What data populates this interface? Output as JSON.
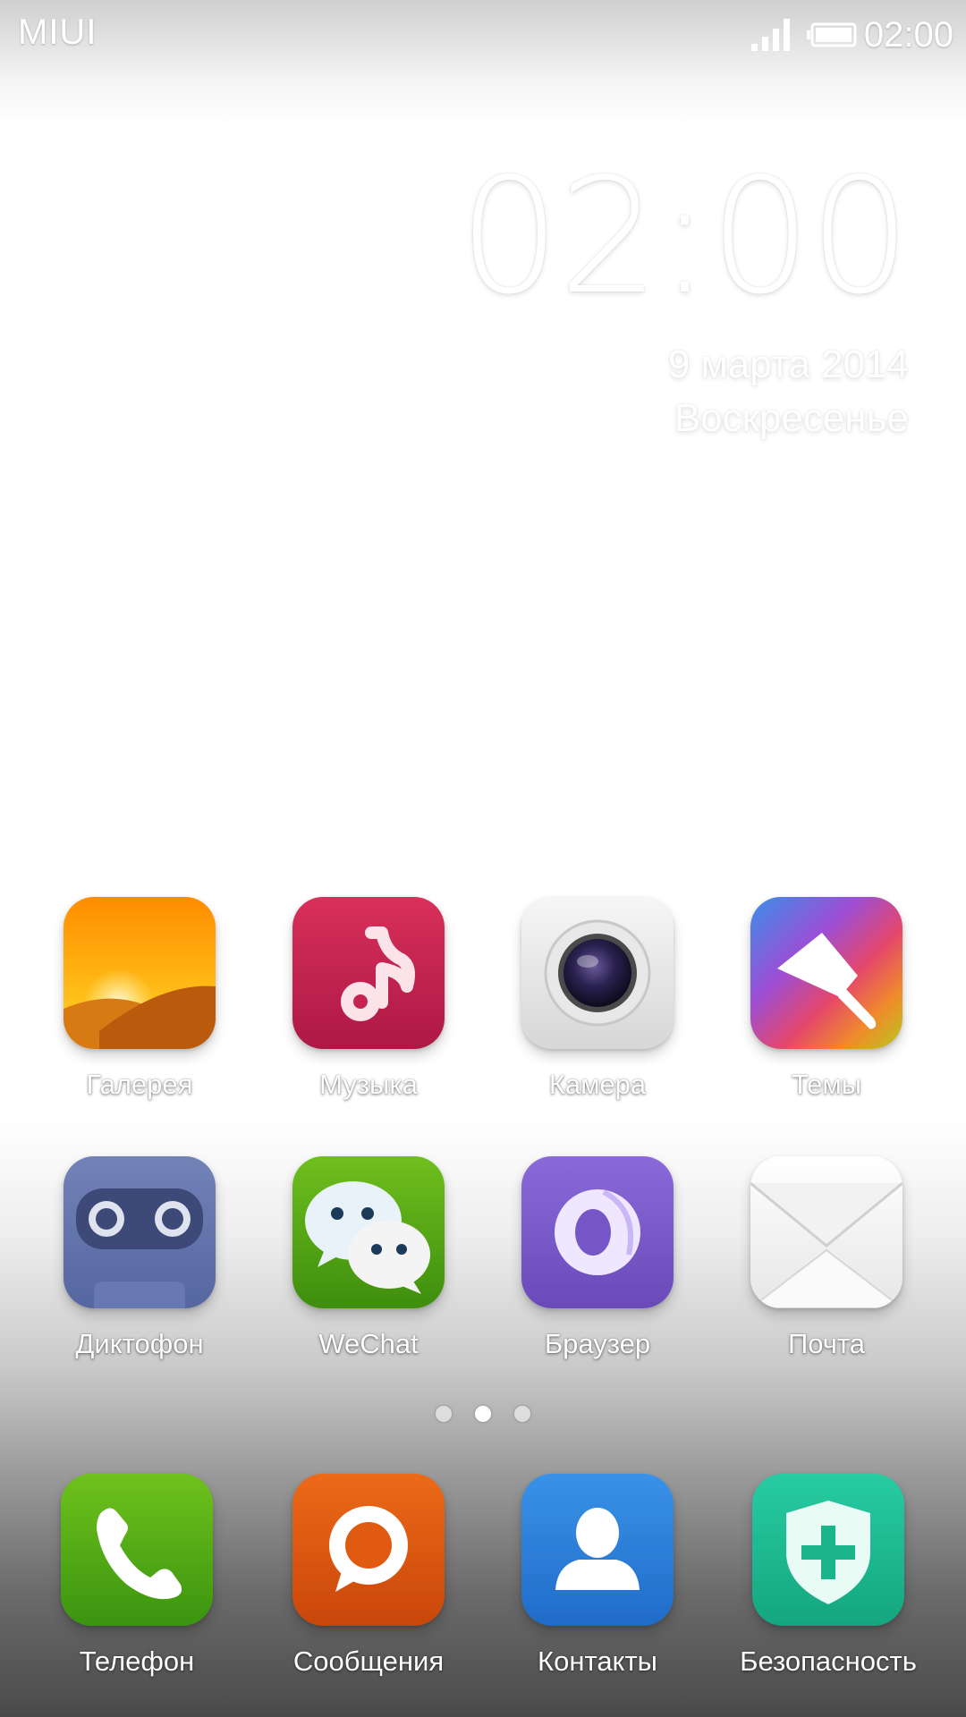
{
  "status_bar": {
    "carrier": "MIUI",
    "time": "02:00"
  },
  "clock_widget": {
    "time": "02:00",
    "date": "9 марта 2014",
    "weekday": "Воскресенье"
  },
  "apps_row1": [
    {
      "label": "Галерея",
      "icon": "gallery-icon"
    },
    {
      "label": "Музыка",
      "icon": "music-icon"
    },
    {
      "label": "Камера",
      "icon": "camera-icon"
    },
    {
      "label": "Темы",
      "icon": "themes-icon"
    }
  ],
  "apps_row2": [
    {
      "label": "Диктофон",
      "icon": "recorder-icon"
    },
    {
      "label": "WeChat",
      "icon": "wechat-icon"
    },
    {
      "label": "Браузер",
      "icon": "browser-icon"
    },
    {
      "label": "Почта",
      "icon": "mail-icon"
    }
  ],
  "page_indicator": {
    "pages": 3,
    "active": 2
  },
  "dock": [
    {
      "label": "Телефон",
      "icon": "phone-icon"
    },
    {
      "label": "Сообщения",
      "icon": "messages-icon"
    },
    {
      "label": "Контакты",
      "icon": "contacts-icon"
    },
    {
      "label": "Безопасность",
      "icon": "security-icon"
    }
  ]
}
